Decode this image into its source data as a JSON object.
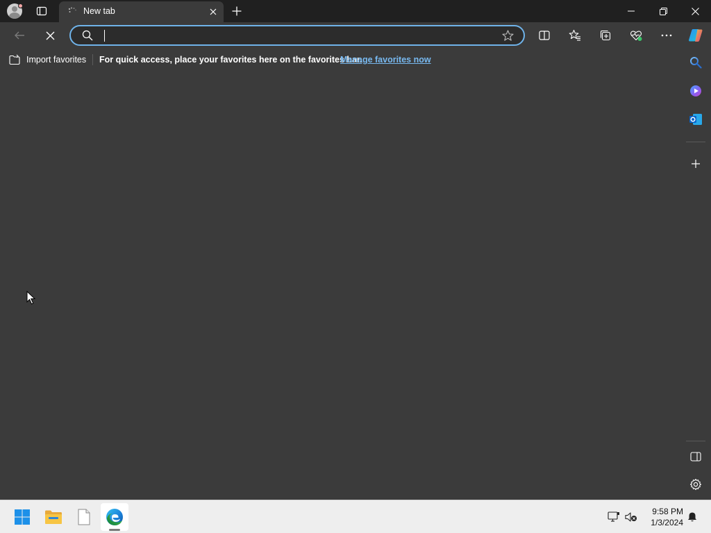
{
  "tab": {
    "title": "New tab"
  },
  "omnibox": {
    "value": "",
    "placeholder": ""
  },
  "favorites_bar": {
    "import_label": "Import favorites",
    "message": "For quick access, place your favorites here on the favorites bar.",
    "manage_link": "Manage favorites now"
  },
  "taskbar": {
    "time": "9:58 PM",
    "date": "1/3/2024"
  },
  "colors": {
    "accent": "#6fb3ea",
    "link": "#78b9f0",
    "page_bg": "#3b3b3b",
    "titlebar_bg": "#202020",
    "taskbar_bg": "#eeeeee"
  },
  "icons": {
    "profile": "profile-avatar-icon",
    "workspaces": "tab-actions-icon",
    "back": "arrow-left-icon",
    "stop": "close-icon",
    "search": "search-icon",
    "favorite": "star-icon",
    "split": "split-screen-icon",
    "favorites": "favorites-icon",
    "collections": "collections-icon",
    "health": "browser-essentials-icon",
    "more": "more-icon",
    "copilot": "copilot-icon"
  }
}
